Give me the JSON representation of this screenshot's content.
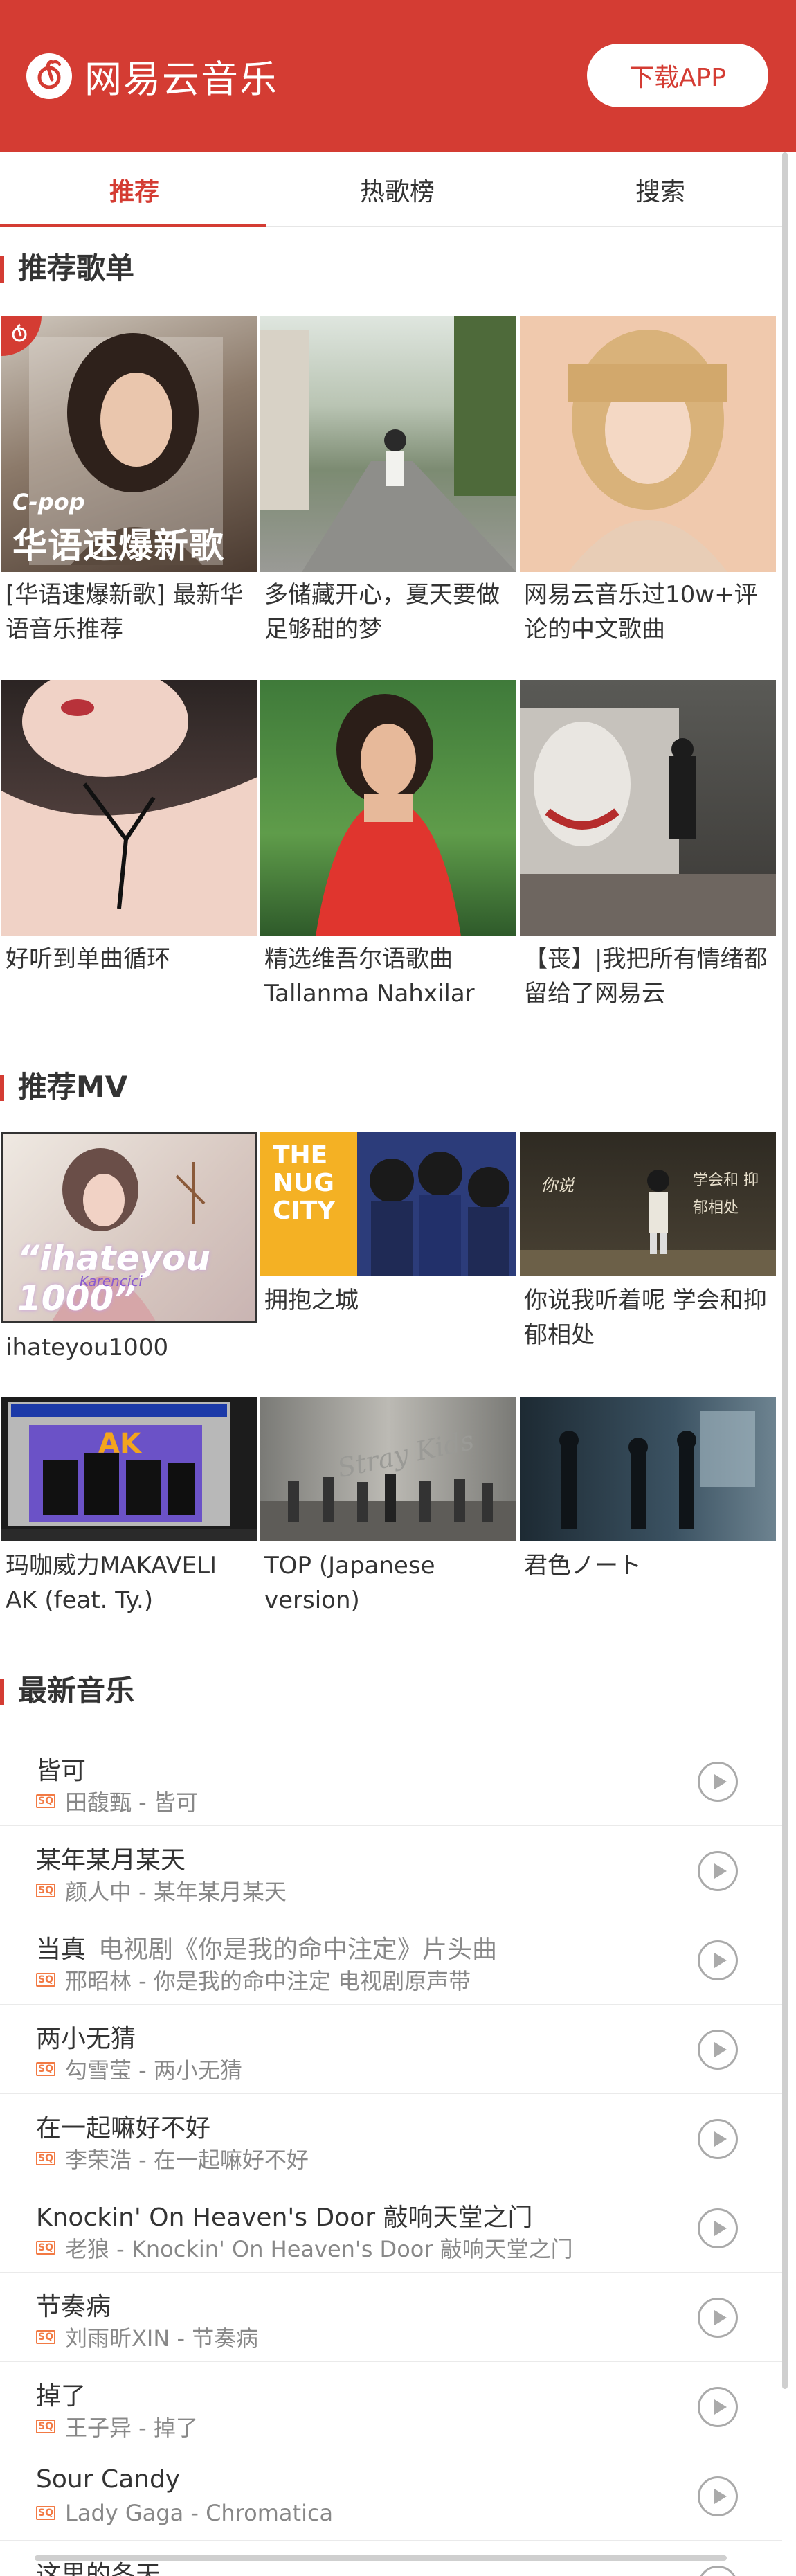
{
  "header": {
    "logo_text": "网易云音乐",
    "download_label": "下载APP",
    "brand_color": "#d43c33"
  },
  "tabs": [
    {
      "label": "推荐",
      "active": true
    },
    {
      "label": "热歌榜",
      "active": false
    },
    {
      "label": "搜索",
      "active": false
    }
  ],
  "playlists": {
    "title": "推荐歌单",
    "items": [
      {
        "caption": "[华语速爆新歌] 最新华语音乐推荐",
        "cover_text_small": "C-pop",
        "cover_text_big": "华语速爆新歌"
      },
      {
        "caption": "多储藏开心，夏天要做足够甜的梦"
      },
      {
        "caption": "网易云音乐过10w+评论的中文歌曲"
      },
      {
        "caption": "好听到单曲循环"
      },
      {
        "caption": "精选维吾尔语歌曲 Tallanma Nahxilar"
      },
      {
        "caption": "【丧】|我把所有情绪都留给了网易云"
      }
    ]
  },
  "mvs": {
    "title": "推荐MV",
    "items": [
      {
        "caption": "ihateyou1000",
        "cover_text": "“ihateyou 1000”",
        "cover_sub": "Karencici"
      },
      {
        "caption": "拥抱之城",
        "cover_text": "THE NUG CITY"
      },
      {
        "caption": "你说我听着呢 学会和抑郁相处",
        "cover_text": "学会和 抑郁相处"
      },
      {
        "caption": "玛咖威力MAKAVELI AK (feat. Ty.)",
        "cover_text": "AK"
      },
      {
        "caption": "TOP (Japanese version)",
        "cover_text": "Stray Kids"
      },
      {
        "caption": "君色ノート"
      }
    ]
  },
  "newsongs": {
    "title": "最新音乐",
    "badge": "SQ",
    "items": [
      {
        "title": "皆可",
        "alias": "",
        "sub": "田馥甄 - 皆可"
      },
      {
        "title": "某年某月某天",
        "alias": "",
        "sub": "颜人中 - 某年某月某天"
      },
      {
        "title": "当真",
        "alias": "电视剧《你是我的命中注定》片头曲",
        "sub": "邢昭林 - 你是我的命中注定 电视剧原声带"
      },
      {
        "title": "两小无猜",
        "alias": "",
        "sub": "勾雪莹 - 两小无猜"
      },
      {
        "title": "在一起嘛好不好",
        "alias": "",
        "sub": "李荣浩 - 在一起嘛好不好"
      },
      {
        "title": "Knockin' On Heaven's Door 敲响天堂之门",
        "alias": "",
        "sub": "老狼 - Knockin' On Heaven's Door 敲响天堂之门"
      },
      {
        "title": "节奏病",
        "alias": "",
        "sub": "刘雨昕XIN - 节奏病"
      },
      {
        "title": "掉了",
        "alias": "",
        "sub": "王子异 - 掉了"
      },
      {
        "title": "Sour Candy",
        "alias": "",
        "sub": "Lady Gaga - Chromatica"
      },
      {
        "title": "这里的冬天",
        "alias": "",
        "sub": ""
      }
    ]
  }
}
